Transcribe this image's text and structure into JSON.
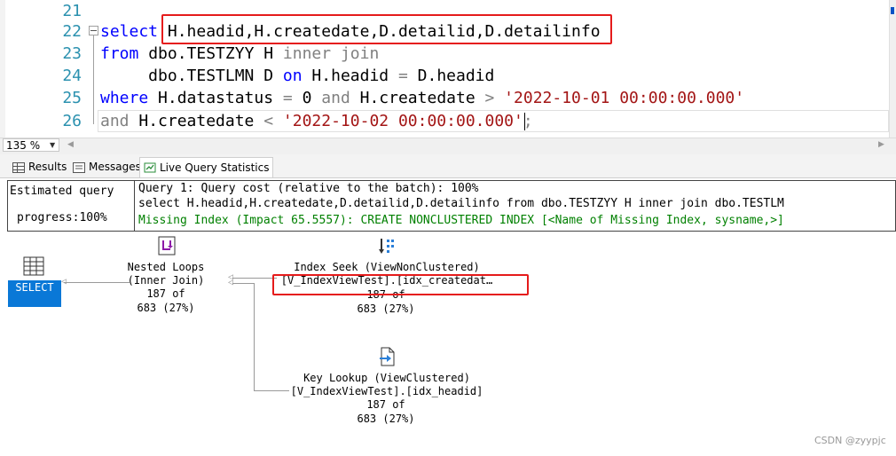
{
  "editor": {
    "lines": [
      {
        "num": "21"
      },
      {
        "num": "22",
        "kw1": "select",
        "t1": " H.headid,H.createdate,D.detailid,D.detailinfo"
      },
      {
        "num": "23",
        "kw1": "from",
        "t1": " dbo.TESTZYY H ",
        "g1": "inner join"
      },
      {
        "num": "24",
        "t0": "     dbo.TESTLMN D ",
        "kw1": "on",
        "t1": " H.headid ",
        "g1": "=",
        "t2": " D.headid"
      },
      {
        "num": "25",
        "kw1": "where",
        "t1": " H.datastatus ",
        "g1": "=",
        "t2": " 0 ",
        "g2": "and",
        "t3": " H.createdate ",
        "g3": ">",
        "s1": " '2022-10-01 00:00:00.000'"
      },
      {
        "num": "26",
        "g1": "and",
        "t1": " H.createdate ",
        "g2": "<",
        "s1": " '2022-10-02 00:00:00.000'",
        "g3": ";"
      }
    ]
  },
  "zoom": {
    "value": "135 %",
    "arrow": "▼"
  },
  "tabs": [
    {
      "label": "Results"
    },
    {
      "label": "Messages"
    },
    {
      "label": "Live Query Statistics"
    }
  ],
  "progress": {
    "line1": "Estimated query",
    "line2": "progress:100%",
    "q1": "Query 1: Query cost (relative to the batch): 100%",
    "q2": "select H.headid,H.createdate,D.detailid,D.detailinfo from dbo.TESTZYY H inner join dbo.TESTLM",
    "q3": "Missing Index (Impact 65.5557): CREATE NONCLUSTERED INDEX [<Name of Missing Index, sysname,>]"
  },
  "plan": {
    "select_label": "SELECT",
    "nested": {
      "l1": "Nested Loops",
      "l2": "(Inner Join)",
      "l3": "187 of",
      "l4": "683 (27%)"
    },
    "seek": {
      "l1": "Index Seek (ViewNonClustered)",
      "l2": "[V_IndexViewTest].[idx_createdat…",
      "l3": "187 of",
      "l4": "683 (27%)"
    },
    "lookup": {
      "l1": "Key Lookup (ViewClustered)",
      "l2": "[V_IndexViewTest].[idx_headid]",
      "l3": "187 of",
      "l4": "683 (27%)"
    }
  },
  "watermark": "CSDN @zyypjc",
  "colors": {
    "highlight": "#e51b1b",
    "keyword": "#0000ff",
    "string": "#a31515",
    "line_number": "#2b91af",
    "select_node": "#0a78d7"
  }
}
